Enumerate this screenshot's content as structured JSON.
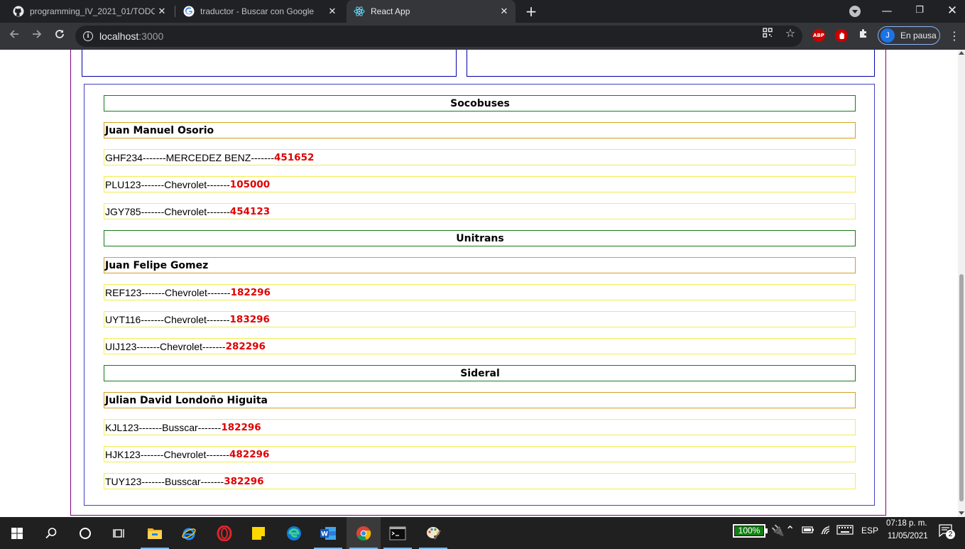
{
  "browser": {
    "tabs": [
      {
        "title": "programming_IV_2021_01/TODO",
        "icon": "github-icon",
        "active": false
      },
      {
        "title": "traductor - Buscar con Google",
        "icon": "google-icon",
        "active": false
      },
      {
        "title": "React App",
        "icon": "react-icon",
        "active": true
      }
    ],
    "url_host": "localhost",
    "url_port": ":3000",
    "profile_initial": "J",
    "profile_status": "En pausa",
    "abp_label": "ABP"
  },
  "companies": [
    {
      "name": "Socobuses",
      "driver": "Juan Manuel Osorio",
      "vehicles": [
        {
          "plate": "GHF234",
          "sep1": "-------",
          "brand": "MERCEDEZ BENZ",
          "sep2": "-------",
          "price": "451652"
        },
        {
          "plate": "PLU123",
          "sep1": "-------",
          "brand": "Chevrolet",
          "sep2": "-------",
          "price": "105000"
        },
        {
          "plate": "JGY785",
          "sep1": "-------",
          "brand": "Chevrolet",
          "sep2": "-------",
          "price": "454123"
        }
      ]
    },
    {
      "name": "Unitrans",
      "driver": "Juan Felipe Gomez",
      "vehicles": [
        {
          "plate": "REF123",
          "sep1": "-------",
          "brand": "Chevrolet",
          "sep2": "-------",
          "price": "182296"
        },
        {
          "plate": "UYT116",
          "sep1": "-------",
          "brand": "Chevrolet",
          "sep2": "-------",
          "price": "183296"
        },
        {
          "plate": "UIJ123",
          "sep1": "-------",
          "brand": "Chevrolet",
          "sep2": "-------",
          "price": "282296"
        }
      ]
    },
    {
      "name": "Sideral",
      "driver": "Julian David Londoño Higuita",
      "vehicles": [
        {
          "plate": "KJL123",
          "sep1": "-------",
          "brand": "Busscar",
          "sep2": "-------",
          "price": "182296"
        },
        {
          "plate": "HJK123",
          "sep1": "-------",
          "brand": "Chevrolet",
          "sep2": "-------",
          "price": "482296"
        },
        {
          "plate": "TUY123",
          "sep1": "-------",
          "brand": "Busscar",
          "sep2": "-------",
          "price": "382296"
        }
      ]
    }
  ],
  "taskbar": {
    "battery": "100%",
    "language": "ESP",
    "time": "07:18 p. m.",
    "date": "11/05/2021",
    "notifications": "2"
  }
}
